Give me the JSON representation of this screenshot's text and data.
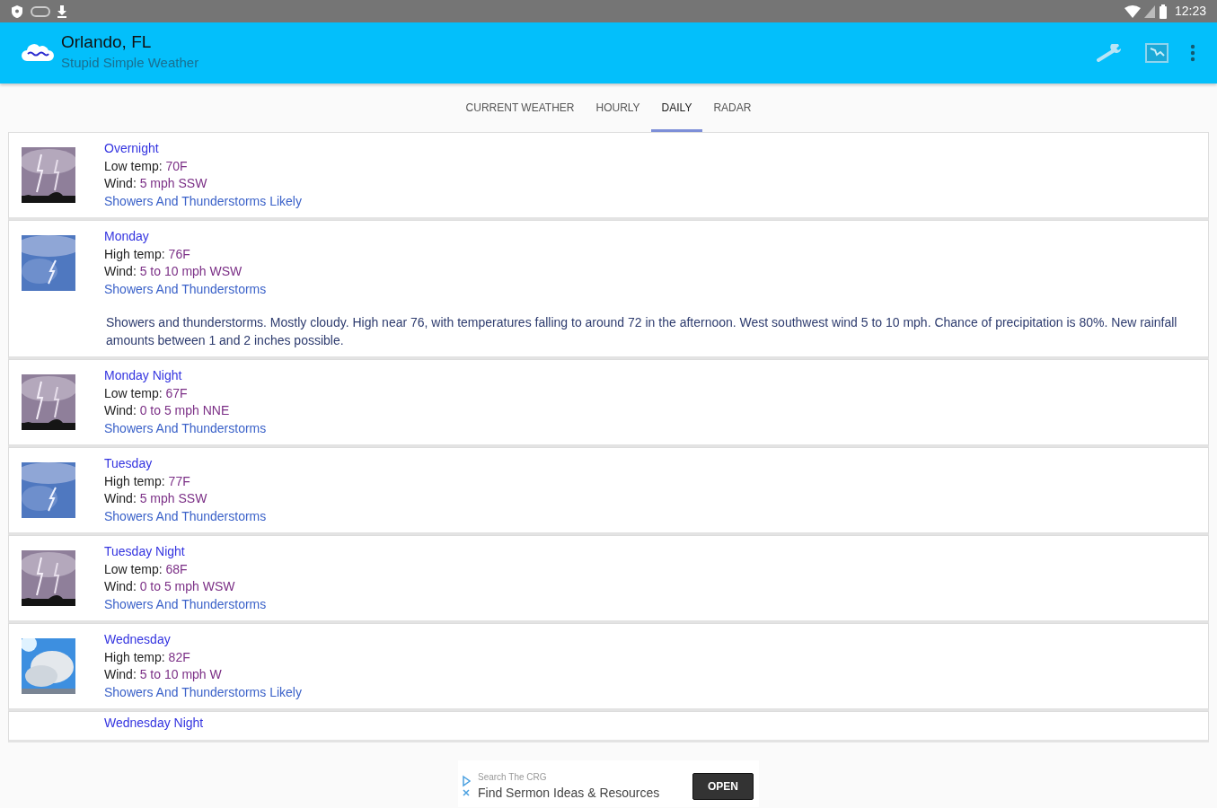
{
  "status_bar": {
    "time": "12:23"
  },
  "app_bar": {
    "title": "Orlando, FL",
    "subtitle": "Stupid Simple Weather"
  },
  "tabs": [
    {
      "label": "CURRENT WEATHER",
      "selected": false
    },
    {
      "label": "HOURLY",
      "selected": false
    },
    {
      "label": "DAILY",
      "selected": true
    },
    {
      "label": "RADAR",
      "selected": false
    }
  ],
  "forecast": [
    {
      "period": "Overnight",
      "temp_label": "Low temp:",
      "temp": "70F",
      "wind_label": "Wind:",
      "wind": "5 mph SSW",
      "condition": "Showers And Thunderstorms Likely"
    },
    {
      "period": "Monday",
      "temp_label": "High temp:",
      "temp": "76F",
      "wind_label": "Wind:",
      "wind": "5 to 10 mph WSW",
      "condition": "Showers And Thunderstorms",
      "description": "Showers and thunderstorms. Mostly cloudy. High near 76, with temperatures falling to around 72 in the afternoon. West southwest wind 5 to 10 mph. Chance of precipitation is 80%. New rainfall amounts between 1 and 2 inches possible."
    },
    {
      "period": "Monday Night",
      "temp_label": "Low temp:",
      "temp": "67F",
      "wind_label": "Wind:",
      "wind": "0 to 5 mph NNE",
      "condition": "Showers And Thunderstorms"
    },
    {
      "period": "Tuesday",
      "temp_label": "High temp:",
      "temp": "77F",
      "wind_label": "Wind:",
      "wind": "5 mph SSW",
      "condition": "Showers And Thunderstorms"
    },
    {
      "period": "Tuesday Night",
      "temp_label": "Low temp:",
      "temp": "68F",
      "wind_label": "Wind:",
      "wind": "0 to 5 mph WSW",
      "condition": "Showers And Thunderstorms"
    },
    {
      "period": "Wednesday",
      "temp_label": "High temp:",
      "temp": "82F",
      "wind_label": "Wind:",
      "wind": "5 to 10 mph W",
      "condition": "Showers And Thunderstorms Likely"
    },
    {
      "period": "Wednesday Night"
    }
  ],
  "ad": {
    "kicker": "Search The CRG",
    "headline": "Find Sermon Ideas & Resources",
    "button": "OPEN"
  }
}
